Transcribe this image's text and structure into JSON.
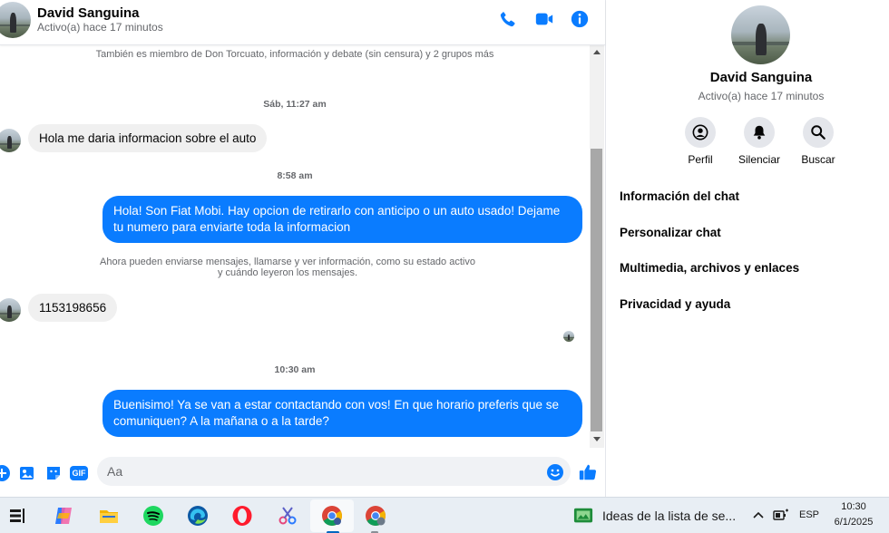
{
  "chat": {
    "contact_name": "David Sanguina",
    "contact_status": "Activo(a) hace 17 minutos",
    "icons": [
      "phone-icon",
      "video-camera-icon",
      "info-icon"
    ],
    "accent_color": "#0a7cff",
    "group_membership": "También es miembro de Don Torcuato, información y debate (sin censura) y 2 grupos más",
    "messages": [
      {
        "type": "time",
        "text": "Sáb, 11:27 am"
      },
      {
        "type": "incoming",
        "text": "Hola me daria informacion sobre el auto"
      },
      {
        "type": "time",
        "text": "8:58 am"
      },
      {
        "type": "outgoing",
        "text": "Hola! Son Fiat Mobi. Hay opcion de retirarlo con anticipo o un auto usado! Dejame tu numero para enviarte toda la informacion"
      },
      {
        "type": "system",
        "line1": "Ahora pueden enviarse mensajes, llamarse y ver información, como su estado activo",
        "line2": "y cuándo leyeron los mensajes."
      },
      {
        "type": "incoming",
        "text": "1153198656"
      },
      {
        "type": "time",
        "text": "10:30 am"
      },
      {
        "type": "outgoing",
        "text": "Buenisimo! Ya se van a estar contactando con vos! En que horario preferis que se comuniquen? A la mañana o a la tarde?"
      }
    ],
    "composer": {
      "placeholder": "Aa",
      "icons": [
        "plus-icon",
        "gallery-icon",
        "sticker-icon",
        "gif-icon",
        "emoji-icon",
        "thumbs-up-icon"
      ],
      "gif_label": "GIF"
    }
  },
  "info_panel": {
    "name": "David Sanguina",
    "status": "Activo(a) hace 17 minutos",
    "actions": [
      {
        "label": "Perfil",
        "icon": "profile-icon"
      },
      {
        "label": "Silenciar",
        "icon": "bell-icon"
      },
      {
        "label": "Buscar",
        "icon": "search-icon"
      }
    ],
    "sections": [
      "Información del chat",
      "Personalizar chat",
      "Multimedia, archivos y enlaces",
      "Privacidad y ayuda"
    ]
  },
  "taskbar": {
    "apps": [
      "task-view-icon",
      "copilot-icon",
      "file-explorer-icon",
      "spotify-icon",
      "edge-icon",
      "opera-icon",
      "snipping-tool-icon",
      "chrome-icon",
      "chrome-profile-icon"
    ],
    "widget_text": "Ideas de la lista de se...",
    "language": "ESP",
    "time": "10:30",
    "date": "6/1/2025"
  }
}
